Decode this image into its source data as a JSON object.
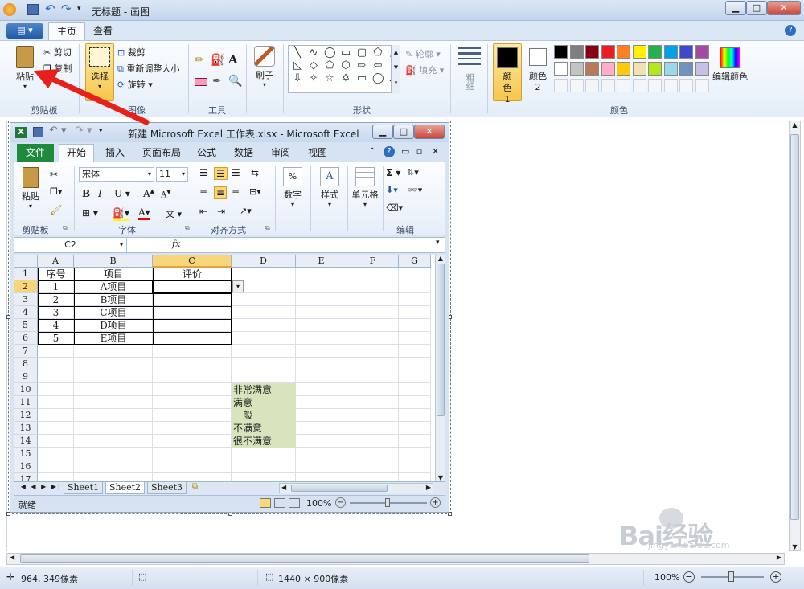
{
  "paint": {
    "title": "无标题 - 画图",
    "menu_label": "▤ ▾",
    "tabs": [
      "主页",
      "查看"
    ],
    "clipboard": {
      "paste": "粘贴",
      "cut": "剪切",
      "copy": "复制",
      "label": "剪贴板"
    },
    "image": {
      "select": "选择",
      "crop": "裁剪",
      "resize": "重新调整大小",
      "rotate": "旋转",
      "label": "图像"
    },
    "tools": {
      "label": "工具"
    },
    "brushes": {
      "label": "刷子"
    },
    "shapes": {
      "outline": "轮廓",
      "fill": "填充",
      "label": "形状"
    },
    "size": {
      "label": "粗细"
    },
    "colors": {
      "color1": "颜色 1",
      "color2": "颜色 2",
      "edit": "编辑颜色",
      "label": "颜色",
      "palette_row1": [
        "#000000",
        "#7f7f7f",
        "#880015",
        "#ed1c24",
        "#ff7f27",
        "#fff200",
        "#22b14c",
        "#00a2e8",
        "#3f48cc",
        "#a349a4"
      ],
      "palette_row2": [
        "#ffffff",
        "#c3c3c3",
        "#b97a57",
        "#ffaec9",
        "#ffc90e",
        "#efe4b0",
        "#b5e61d",
        "#99d9ea",
        "#7092be",
        "#c8bfe7"
      ]
    },
    "status": {
      "cursor": "964, 349像素",
      "canvas_size": "1440 × 900像素",
      "zoom": "100%"
    },
    "watermark": {
      "brand": "Bai经验",
      "url": "jingyan.baidu.com"
    }
  },
  "excel": {
    "title": "新建 Microsoft Excel 工作表.xlsx - Microsoft Excel",
    "tabs": [
      "文件",
      "开始",
      "插入",
      "页面布局",
      "公式",
      "数据",
      "审阅",
      "视图"
    ],
    "ribbon": {
      "paste": "粘贴",
      "clipboard_label": "剪贴板",
      "font_name": "宋体",
      "font_size": "11",
      "font_label": "字体",
      "align_label": "对齐方式",
      "number": "数字",
      "styles": "样式",
      "cells": "单元格",
      "edit_label": "编辑"
    },
    "name_box": "C2",
    "fx": "fx",
    "columns": [
      "A",
      "B",
      "C",
      "D",
      "E",
      "F",
      "G"
    ],
    "rows": [
      "1",
      "2",
      "3",
      "4",
      "5",
      "6",
      "7",
      "8",
      "9",
      "10",
      "11",
      "12",
      "13",
      "14",
      "15",
      "16",
      "17"
    ],
    "table": {
      "headers": [
        "序号",
        "项目",
        "评价"
      ],
      "rows": [
        [
          "1",
          "A项目"
        ],
        [
          "2",
          "B项目"
        ],
        [
          "3",
          "C项目"
        ],
        [
          "4",
          "D项目"
        ],
        [
          "5",
          "E项目"
        ]
      ]
    },
    "options": [
      "非常满意",
      "满意",
      "一般",
      "不满意",
      "很不满意"
    ],
    "sheets": [
      "Sheet1",
      "Sheet2",
      "Sheet3"
    ],
    "status": {
      "ready": "就绪",
      "zoom": "100%"
    }
  }
}
